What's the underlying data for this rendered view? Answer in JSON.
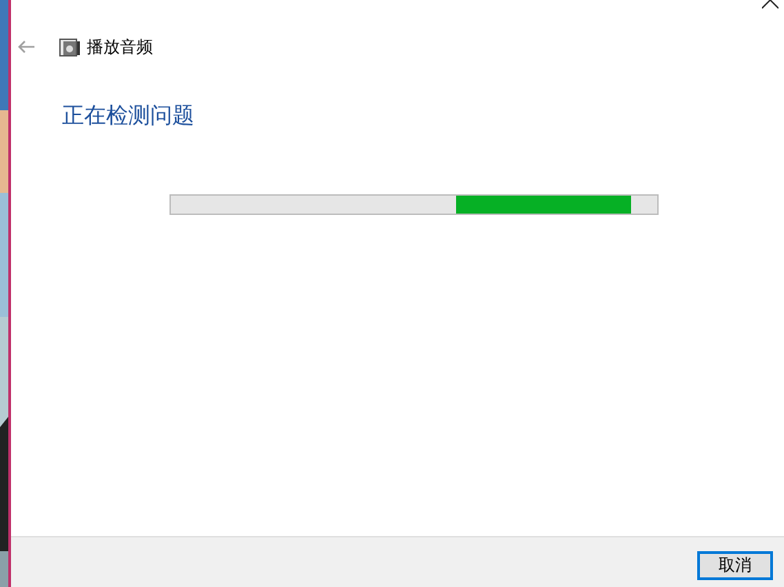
{
  "window": {
    "title": "播放音频"
  },
  "heading": "正在检测问题",
  "progress": {
    "kind": "marquee",
    "level": 0.946
  },
  "buttons": [
    {
      "label": "取消",
      "focused": true
    }
  ]
}
